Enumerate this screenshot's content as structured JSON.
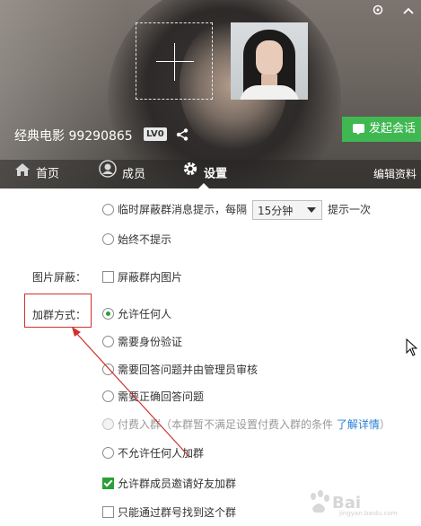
{
  "header": {
    "group_name": "经典电影 99290865",
    "level_badge": "LV0",
    "start_chat_label": "发起会话"
  },
  "tabs": [
    {
      "label": "首页",
      "icon": "home-icon"
    },
    {
      "label": "成员",
      "icon": "user-icon"
    },
    {
      "label": "设置",
      "icon": "gear-icon",
      "active": true
    },
    {
      "label": "编辑资料"
    }
  ],
  "settings": {
    "msg_alert": {
      "option_temp": "临时屏蔽群消息提示，每隔",
      "interval_value": "15分钟",
      "option_temp_suffix": "提示一次",
      "option_never": "始终不提示"
    },
    "image_block": {
      "label": "图片屏蔽：",
      "option": "屏蔽群内图片"
    },
    "join_method": {
      "label": "加群方式：",
      "options": [
        {
          "text": "允许任何人",
          "checked": true
        },
        {
          "text": "需要身份验证",
          "checked": false
        },
        {
          "text": "需要回答问题并由管理员审核",
          "checked": false
        },
        {
          "text": "需要正确回答问题",
          "checked": false
        },
        {
          "text": "付费入群（本群暂不满足设置付费入群的条件",
          "link": "了解详情",
          "close": "）",
          "disabled": true
        },
        {
          "text": "不允许任何人加群",
          "checked": false
        }
      ]
    },
    "invite_friends": {
      "text": "允许群成员邀请好友加群",
      "checked": true
    },
    "search_only_by_number": {
      "text": "只能通过群号找到这个群",
      "checked": false
    }
  },
  "watermark": {
    "text": "Bai",
    "sub": "jingyan.baidu.com"
  },
  "colors": {
    "accent_green": "#3fb852",
    "highlight_red": "#d0312d",
    "link_blue": "#2a7fd4"
  }
}
